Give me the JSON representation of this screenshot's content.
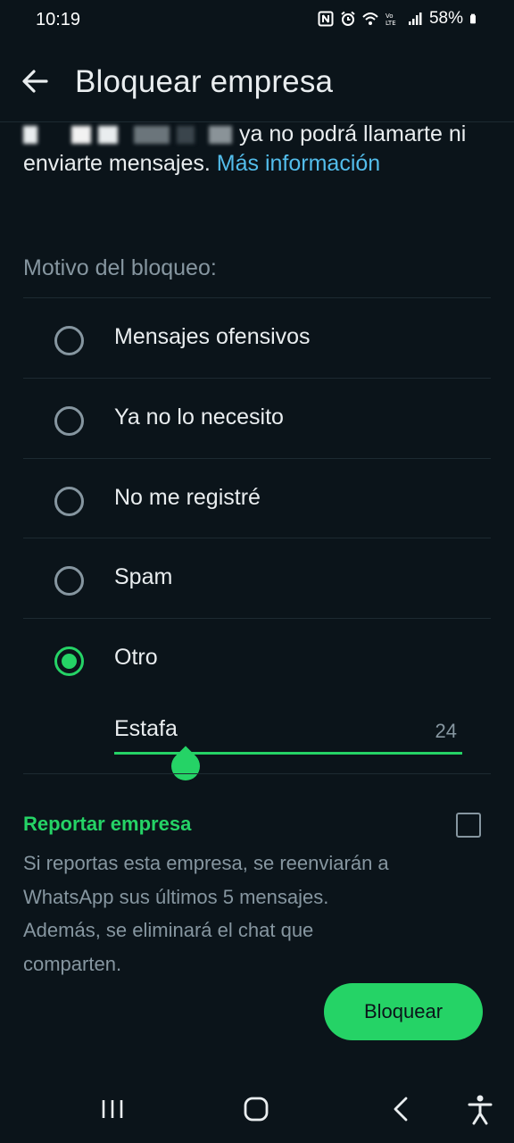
{
  "status_bar": {
    "time": "10:19",
    "battery": "58%",
    "icons": [
      "nfc-icon",
      "alarm-icon",
      "wifi-icon",
      "volte-icon",
      "signal-icon",
      "battery-icon"
    ]
  },
  "header": {
    "title": "Bloquear empresa",
    "back_icon": "back-arrow-icon"
  },
  "description": {
    "text_after_name": "ya no podrá llamarte ni enviarte mensajes.",
    "link": "Más información"
  },
  "reason": {
    "label": "Motivo del bloqueo:",
    "options": [
      {
        "label": "Mensajes ofensivos",
        "selected": false
      },
      {
        "label": "Ya no lo necesito",
        "selected": false
      },
      {
        "label": "No me registré",
        "selected": false
      },
      {
        "label": "Spam",
        "selected": false
      },
      {
        "label": "Otro",
        "selected": true
      }
    ],
    "other_value": "Estafa",
    "other_counter": "24"
  },
  "report": {
    "title": "Reportar empresa",
    "checked": false,
    "body": "Si reportas esta empresa, se reenviarán a WhatsApp sus últimos 5 mensajes. Además, se eliminará el chat que comparten."
  },
  "actions": {
    "block_label": "Bloquear"
  },
  "navigation": [
    "recent-apps-icon",
    "home-icon",
    "back-icon",
    "accessibility-icon"
  ],
  "colors": {
    "background": "#0b141a",
    "accent": "#25d366",
    "link": "#53bdeb",
    "secondary_text": "#8696a0"
  }
}
